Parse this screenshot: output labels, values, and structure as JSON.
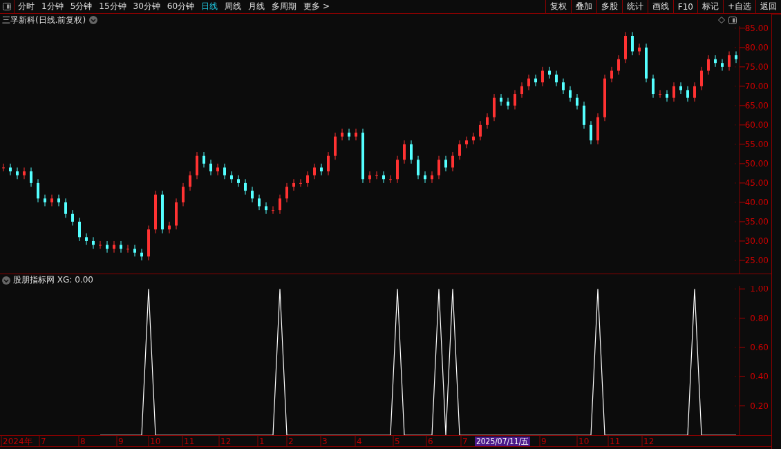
{
  "toolbar": {
    "periods": [
      {
        "label": "分时",
        "selected": false
      },
      {
        "label": "1分钟",
        "selected": false
      },
      {
        "label": "5分钟",
        "selected": false
      },
      {
        "label": "15分钟",
        "selected": false
      },
      {
        "label": "30分钟",
        "selected": false
      },
      {
        "label": "60分钟",
        "selected": false
      },
      {
        "label": "日线",
        "selected": true
      },
      {
        "label": "周线",
        "selected": false
      },
      {
        "label": "月线",
        "selected": false
      },
      {
        "label": "多周期",
        "selected": false
      },
      {
        "label": "更多 >",
        "selected": false
      }
    ],
    "actions": [
      "复权",
      "叠加",
      "多股",
      "统计",
      "画线",
      "F10",
      "标记",
      "+自选",
      "返回"
    ]
  },
  "price_chart": {
    "title": "三孚新科(日线.前复权)",
    "chart_data": {
      "type": "candlestick",
      "ylim": [
        21.6,
        85.5
      ],
      "yticks": [
        {
          "value": 85,
          "label": "85.00"
        },
        {
          "value": 80,
          "label": "80.00"
        },
        {
          "value": 75,
          "label": "75.00"
        },
        {
          "value": 70,
          "label": "70.00"
        },
        {
          "value": 65,
          "label": "65.00"
        },
        {
          "value": 60,
          "label": "60.00"
        },
        {
          "value": 55,
          "label": "55.00"
        },
        {
          "value": 50,
          "label": "50.00"
        },
        {
          "value": 45,
          "label": "45.00"
        },
        {
          "value": 40,
          "label": "40.00"
        },
        {
          "value": 35,
          "label": "35.00"
        },
        {
          "value": 30,
          "label": "30.00"
        },
        {
          "value": 25,
          "label": "25.00"
        }
      ],
      "categories": [
        null,
        null,
        null,
        null,
        null,
        null,
        null,
        null,
        null,
        null,
        null,
        null,
        null,
        null,
        null,
        null,
        null,
        null,
        null,
        null,
        null,
        null,
        null,
        null,
        null,
        null,
        null,
        null,
        null,
        null,
        null,
        null,
        null,
        null,
        null,
        null,
        null,
        null,
        null,
        null,
        null,
        null,
        null,
        null,
        null,
        null,
        null,
        null,
        null,
        null,
        null,
        null,
        null,
        null,
        null,
        null,
        null,
        null,
        null,
        null,
        null,
        null,
        null,
        null,
        null,
        null,
        null,
        null,
        null,
        null,
        null,
        null,
        null,
        null,
        null,
        null,
        null,
        null,
        null,
        null,
        null,
        null,
        null,
        null,
        null,
        null,
        null,
        null,
        null,
        null,
        null,
        null,
        null,
        null,
        null,
        null,
        null,
        null,
        null,
        null,
        null,
        null,
        null,
        null,
        null,
        null,
        null
      ],
      "ohlc": [
        [
          49,
          50,
          48,
          49
        ],
        [
          49,
          50,
          47,
          48
        ],
        [
          48,
          49,
          46,
          47
        ],
        [
          47,
          49,
          46,
          48
        ],
        [
          48,
          49,
          44,
          45
        ],
        [
          45,
          46,
          40,
          41
        ],
        [
          41,
          42,
          39,
          40
        ],
        [
          40,
          42,
          39,
          41
        ],
        [
          41,
          42,
          39,
          40
        ],
        [
          40,
          41,
          36,
          37
        ],
        [
          37,
          38,
          34,
          35
        ],
        [
          35,
          36,
          30,
          31
        ],
        [
          31,
          32,
          29,
          30
        ],
        [
          30,
          31,
          28,
          29
        ],
        [
          29,
          30,
          28,
          29
        ],
        [
          29,
          30,
          27,
          28
        ],
        [
          28,
          30,
          27,
          29
        ],
        [
          29,
          30,
          27,
          28
        ],
        [
          28,
          29,
          27,
          28
        ],
        [
          28,
          29,
          26,
          27
        ],
        [
          27,
          28,
          25,
          26
        ],
        [
          26,
          34,
          25,
          33
        ],
        [
          33,
          43,
          32,
          42
        ],
        [
          42,
          43,
          32,
          33
        ],
        [
          33,
          35,
          32,
          34
        ],
        [
          34,
          41,
          33,
          40
        ],
        [
          40,
          45,
          39,
          44
        ],
        [
          44,
          48,
          43,
          47
        ],
        [
          47,
          53,
          46,
          52
        ],
        [
          52,
          53,
          49,
          50
        ],
        [
          50,
          51,
          47,
          48
        ],
        [
          48,
          50,
          47,
          49
        ],
        [
          49,
          50,
          46,
          47
        ],
        [
          47,
          48,
          45,
          46
        ],
        [
          46,
          47,
          44,
          45
        ],
        [
          45,
          46,
          42,
          43
        ],
        [
          43,
          44,
          40,
          41
        ],
        [
          41,
          42,
          38,
          39
        ],
        [
          39,
          40,
          37,
          38
        ],
        [
          38,
          39,
          37,
          38
        ],
        [
          38,
          42,
          37,
          41
        ],
        [
          41,
          45,
          40,
          44
        ],
        [
          44,
          46,
          43,
          45
        ],
        [
          45,
          46,
          44,
          45
        ],
        [
          45,
          48,
          44,
          47
        ],
        [
          47,
          50,
          46,
          49
        ],
        [
          49,
          50,
          47,
          48
        ],
        [
          48,
          53,
          47,
          52
        ],
        [
          52,
          58,
          51,
          57
        ],
        [
          57,
          59,
          56,
          58
        ],
        [
          58,
          59,
          56,
          57
        ],
        [
          57,
          59,
          56,
          58
        ],
        [
          58,
          59,
          45,
          46
        ],
        [
          46,
          48,
          45,
          47
        ],
        [
          47,
          48,
          46,
          47
        ],
        [
          47,
          48,
          45,
          46
        ],
        [
          46,
          47,
          45,
          46
        ],
        [
          46,
          52,
          45,
          51
        ],
        [
          51,
          56,
          50,
          55
        ],
        [
          55,
          56,
          50,
          51
        ],
        [
          51,
          52,
          46,
          47
        ],
        [
          47,
          48,
          45,
          46
        ],
        [
          46,
          48,
          45,
          47
        ],
        [
          47,
          52,
          46,
          51
        ],
        [
          51,
          52,
          48,
          49
        ],
        [
          49,
          53,
          48,
          52
        ],
        [
          52,
          56,
          51,
          55
        ],
        [
          55,
          57,
          54,
          56
        ],
        [
          56,
          58,
          55,
          57
        ],
        [
          57,
          61,
          56,
          60
        ],
        [
          60,
          63,
          59,
          62
        ],
        [
          62,
          68,
          61,
          67
        ],
        [
          67,
          68,
          65,
          66
        ],
        [
          66,
          67,
          64,
          65
        ],
        [
          65,
          69,
          64,
          68
        ],
        [
          68,
          71,
          67,
          70
        ],
        [
          70,
          73,
          69,
          72
        ],
        [
          72,
          73,
          70,
          71
        ],
        [
          71,
          75,
          70,
          74
        ],
        [
          74,
          75,
          72,
          73
        ],
        [
          73,
          74,
          70,
          71
        ],
        [
          71,
          72,
          68,
          69
        ],
        [
          69,
          70,
          66,
          67
        ],
        [
          67,
          68,
          64,
          65
        ],
        [
          65,
          66,
          59,
          60
        ],
        [
          60,
          61,
          55,
          56
        ],
        [
          56,
          63,
          55,
          62
        ],
        [
          62,
          73,
          61,
          72
        ],
        [
          72,
          75,
          71,
          74
        ],
        [
          74,
          78,
          73,
          77
        ],
        [
          77,
          84,
          76,
          83
        ],
        [
          83,
          84,
          78,
          79
        ],
        [
          79,
          81,
          78,
          80
        ],
        [
          80,
          81,
          71,
          72
        ],
        [
          72,
          73,
          67,
          68
        ],
        [
          68,
          69,
          67,
          68
        ],
        [
          68,
          69,
          66,
          67
        ],
        [
          67,
          71,
          66,
          70
        ],
        [
          70,
          71,
          68,
          69
        ],
        [
          69,
          70,
          66,
          67
        ],
        [
          67,
          71,
          66,
          70
        ],
        [
          70,
          75,
          69,
          74
        ],
        [
          74,
          78,
          73,
          77
        ],
        [
          77,
          78,
          75,
          76
        ],
        [
          76,
          77,
          74,
          75
        ],
        [
          75,
          79,
          74,
          78
        ],
        [
          78,
          79,
          76,
          77
        ]
      ]
    }
  },
  "indicator": {
    "title": "股朋指标网 XG: 0.00",
    "chart_data": {
      "type": "line",
      "ylim": [
        0,
        1.02
      ],
      "yticks": [
        {
          "value": 1,
          "label": "1.00"
        },
        {
          "value": 0.8,
          "label": "0.80"
        },
        {
          "value": 0.6,
          "label": "0.60"
        },
        {
          "value": 0.4,
          "label": "0.40"
        },
        {
          "value": 0.2,
          "label": "0.20"
        }
      ],
      "series": [
        {
          "color": "#ffffff",
          "values": [
            null,
            null,
            null,
            null,
            null,
            null,
            null,
            null,
            null,
            null,
            null,
            null,
            null,
            null,
            0,
            0,
            0,
            0,
            0,
            0,
            0,
            1,
            0,
            0,
            0,
            0,
            0,
            0,
            0,
            0,
            0,
            0,
            0,
            0,
            0,
            0,
            0,
            0,
            0,
            0,
            1,
            0,
            0,
            0,
            0,
            0,
            0,
            0,
            0,
            0,
            0,
            0,
            0,
            0,
            0,
            0,
            0,
            1,
            0,
            0,
            0,
            0,
            0,
            1,
            0,
            1,
            0,
            0,
            0,
            0,
            0,
            0,
            0,
            0,
            0,
            0,
            0,
            0,
            0,
            0,
            0,
            0,
            0,
            0,
            0,
            0,
            1,
            0,
            0,
            0,
            0,
            0,
            0,
            0,
            0,
            0,
            0,
            0,
            0,
            0,
            1,
            0,
            0,
            0,
            0,
            0,
            0
          ]
        }
      ]
    }
  },
  "x_axis": {
    "ticks": [
      {
        "label": "2024年",
        "kind": "tick"
      },
      {
        "label": "7",
        "kind": "tick"
      },
      {
        "label": "8",
        "kind": "tick"
      },
      {
        "label": "9",
        "kind": "tick"
      },
      {
        "label": "10",
        "kind": "tick"
      },
      {
        "label": "11",
        "kind": "tick"
      },
      {
        "label": "12",
        "kind": "tick"
      },
      {
        "label": "1",
        "kind": "tick"
      },
      {
        "label": "2",
        "kind": "tick"
      },
      {
        "label": "3",
        "kind": "tick"
      },
      {
        "label": "4",
        "kind": "tick"
      },
      {
        "label": "5",
        "kind": "tick"
      },
      {
        "label": "6",
        "kind": "tick"
      },
      {
        "label": "7",
        "kind": "tick"
      },
      {
        "label": "2025/07/11/五",
        "kind": "cursor"
      },
      {
        "label": "9",
        "kind": "tick"
      },
      {
        "label": "10",
        "kind": "tick"
      },
      {
        "label": "11",
        "kind": "tick"
      },
      {
        "label": "12",
        "kind": "tick"
      }
    ]
  }
}
